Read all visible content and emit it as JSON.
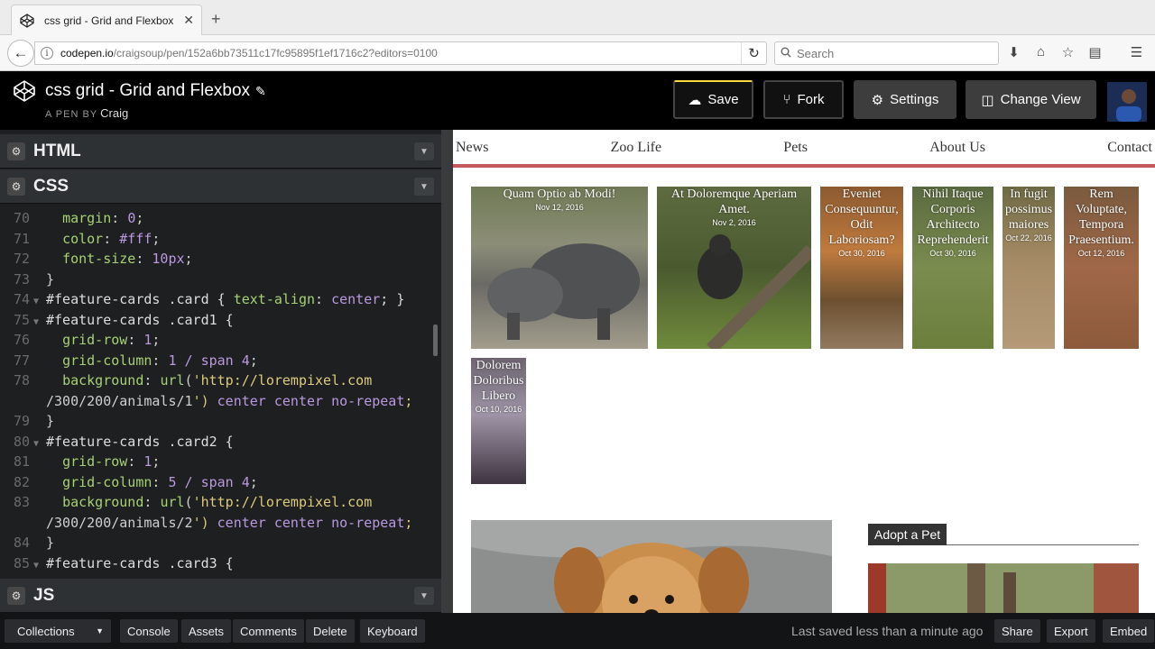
{
  "browser": {
    "tab_title": "css grid - Grid and Flexbox",
    "url_host": "codepen.io",
    "url_path": "/craigsoup/pen/152a6bb73511c17fc95895f1ef1716c2?editors=0100",
    "search_placeholder": "Search"
  },
  "codepen": {
    "pen_title": "css grid - Grid and Flexbox",
    "pen_by_label": "A PEN BY",
    "author": "Craig",
    "save_label": "Save",
    "fork_label": "Fork",
    "settings_label": "Settings",
    "change_view_label": "Change View"
  },
  "panels": {
    "html_label": "HTML",
    "css_label": "CSS",
    "js_label": "JS"
  },
  "code_lines": [
    {
      "n": "70",
      "text": "  margin: 0;"
    },
    {
      "n": "71",
      "text": "  color: #fff;"
    },
    {
      "n": "72",
      "text": "  font-size: 10px;"
    },
    {
      "n": "73",
      "text": "}"
    },
    {
      "n": "74",
      "text": "#feature-cards .card { text-align: center; }"
    },
    {
      "n": "75",
      "text": "#feature-cards .card1 {"
    },
    {
      "n": "76",
      "text": "  grid-row: 1;"
    },
    {
      "n": "77",
      "text": "  grid-column: 1 / span 4;"
    },
    {
      "n": "78",
      "text": "  background: url('http://lorempixel.com"
    },
    {
      "n": "",
      "text": "/300/200/animals/1') center center no-repeat;"
    },
    {
      "n": "79",
      "text": "}"
    },
    {
      "n": "80",
      "text": "#feature-cards .card2 {"
    },
    {
      "n": "81",
      "text": "  grid-row: 1;"
    },
    {
      "n": "82",
      "text": "  grid-column: 5 / span 4;"
    },
    {
      "n": "83",
      "text": "  background: url('http://lorempixel.com"
    },
    {
      "n": "",
      "text": "/300/200/animals/2') center center no-repeat;"
    },
    {
      "n": "84",
      "text": "}"
    },
    {
      "n": "85",
      "text": "#feature-cards .card3 {"
    }
  ],
  "site": {
    "nav": [
      "News",
      "Zoo Life",
      "Pets",
      "About Us",
      "Contact"
    ],
    "cards": [
      {
        "title": "Quam Optio ab Modi!",
        "date": "Nov 12, 2016"
      },
      {
        "title": "At Doloremque Aperiam Amet.",
        "date": "Nov 2, 2016"
      },
      {
        "title": "Eveniet Consequuntur, Odit Laboriosam?",
        "date": "Oct 30, 2016"
      },
      {
        "title": "Nihil Itaque Corporis Architecto Reprehenderit",
        "date": "Oct 30, 2016"
      },
      {
        "title": "In fugit possimus maiores",
        "date": "Oct 22, 2016"
      },
      {
        "title": "Rem Voluptate, Tempora Praesentium.",
        "date": "Oct 12, 2016"
      },
      {
        "title": "Dolorem Doloribus Libero",
        "date": "Oct 10, 2016"
      }
    ],
    "adopt_label": "Adopt a Pet"
  },
  "bottom_bar": {
    "collections": "Collections",
    "console": "Console",
    "assets": "Assets",
    "comments": "Comments",
    "delete": "Delete",
    "keyboard": "Keyboard",
    "saved_status": "Last saved less than a minute ago",
    "share": "Share",
    "export": "Export",
    "embed": "Embed"
  }
}
